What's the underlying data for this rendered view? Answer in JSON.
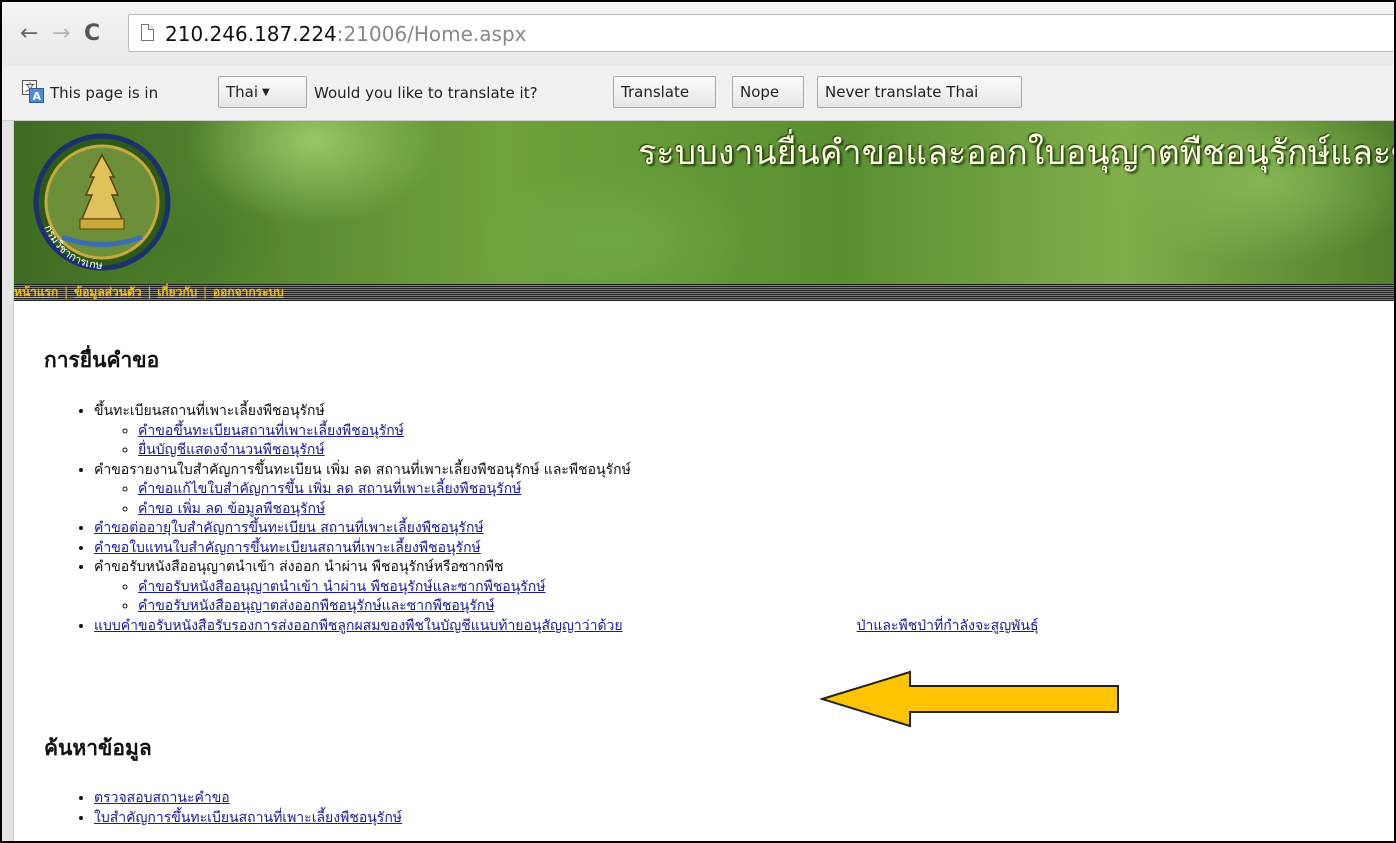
{
  "browser": {
    "url_host": "210.246.187.224",
    "url_path": ":21006/Home.aspx",
    "nav_icons": [
      "back-arrow-icon",
      "forward-arrow-icon",
      "reload-icon",
      "page-icon"
    ]
  },
  "translate_bar": {
    "text_page_in": "This page is in",
    "language": "Thai",
    "question": "Would you like to translate it?",
    "translate_label": "Translate",
    "nope_label": "Nope",
    "never_label": "Never translate Thai"
  },
  "banner": {
    "title": "ระบบงานยื่นคำขอและออกใบอนุญาตพืชอนุรักษ์และซา",
    "logo_text": "กรมวิชาการเกษตร"
  },
  "menu": {
    "home": "หน้าแรก",
    "profile": "ข้อมูลส่วนตัว",
    "about": "เกี่ยวกับ",
    "logout": "ออกจากระบบ",
    "separator": "|"
  },
  "section1": {
    "title": "การยื่นคำขอ",
    "item1": "ขึ้นทะเบียนสถานที่เพาะเลี้ยงพืชอนุรักษ์",
    "item1_sub1": "คำขอขึ้นทะเบียนสถานที่เพาะเลี้ยงพืชอนุรักษ์",
    "item1_sub2": "ยื่นบัญชีแสดงจำนวนพืชอนุรักษ์",
    "item2": "คำขอรายงานใบสำคัญการขึ้นทะเบียน เพิ่ม ลด สถานที่เพาะเลี้ยงพืชอนุรักษ์ และพืชอนุรักษ์",
    "item2_sub1": "คำขอแก้ไขใบสำคัญการขึ้น เพิ่ม ลด สถานที่เพาะเลี้ยงพืชอนุรักษ์",
    "item2_sub2": "คำขอ เพิ่ม ลด ข้อมูลพืชอนุรักษ์",
    "item3": "คำขอต่ออายุใบสำคัญการขึ้นทะเบียน สถานที่เพาะเลี้ยงพืชอนุรักษ์",
    "item4": "คำขอใบแทนใบสำคัญการขึ้นทะเบียนสถานที่เพาะเลี้ยงพืชอนุรักษ์",
    "item5": "คำขอรับหนังสืออนุญาตนำเข้า ส่งออก นำผ่าน พืชอนุรักษ์หรือซากพืช",
    "item5_sub1": "คำขอรับหนังสืออนุญาตนำเข้า นำผ่าน พืชอนุรักษ์และซากพืชอนุรักษ์",
    "item5_sub2": "คำขอรับหนังสืออนุญาตส่งออกพืชอนุรักษ์และซากพืชอนุรักษ์",
    "item6_left": "แบบคำขอรับหนังสือรับรองการส่งออกพืชลูกผสมของพืชในบัญชีแนบท้ายอนุสัญญาว่าด้วย",
    "item6_right": "ป่าและพืชป่าที่กำลังจะสูญพันธุ์"
  },
  "section2": {
    "title": "ค้นหาข้อมูล",
    "item1": "ตรวจสอบสถานะคำขอ",
    "item2": "ใบสำคัญการขึ้นทะเบียนสถานที่เพาะเลี้ยงพืชอนุรักษ์"
  },
  "colors": {
    "link": "#1a1a9c",
    "menu_link": "#f0c020",
    "arrow_fill": "#ffc400",
    "arrow_stroke": "#222222"
  }
}
